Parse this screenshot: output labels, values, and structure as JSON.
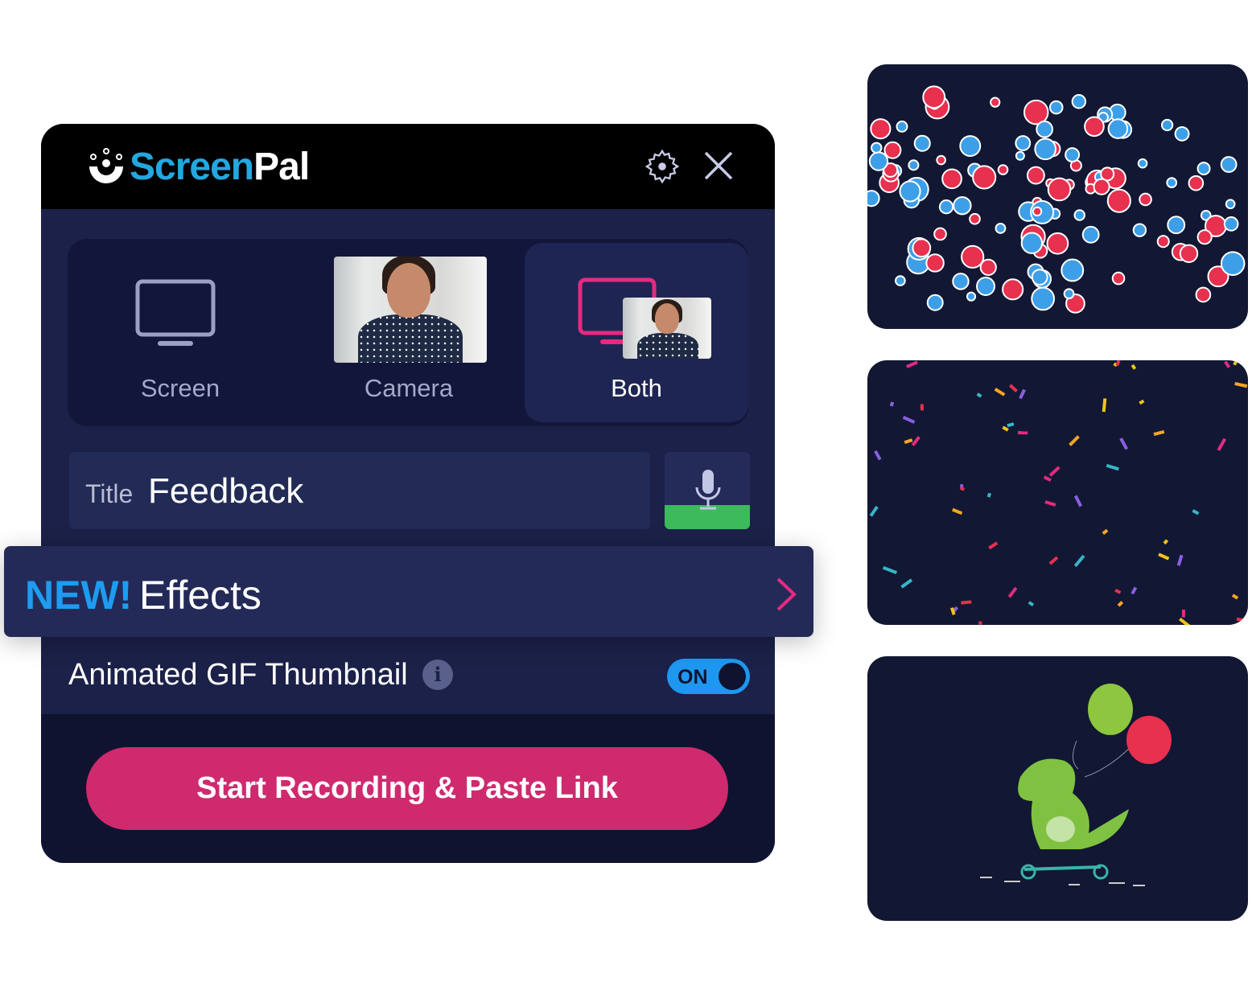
{
  "app": {
    "logo_part1": "Screen",
    "logo_part2": "Pal"
  },
  "header": {
    "settings_icon": "gear-icon",
    "close_icon": "close-icon"
  },
  "modes": [
    {
      "label": "Screen",
      "selected": false
    },
    {
      "label": "Camera",
      "selected": false
    },
    {
      "label": "Both",
      "selected": true
    }
  ],
  "title_field": {
    "label": "Title",
    "value": "Feedback"
  },
  "mic": {
    "icon": "microphone-icon",
    "level_color": "#3dbb5c"
  },
  "effects": {
    "badge": "NEW!",
    "label": "Effects"
  },
  "gif_thumbnail": {
    "label": "Animated GIF Thumbnail",
    "info_icon": "i",
    "toggle": "ON",
    "enabled": true
  },
  "record_button": {
    "label": "Start Recording & Paste Link",
    "color": "#cf2a6e"
  },
  "effect_previews": [
    {
      "name": "hearts-and-likes"
    },
    {
      "name": "confetti"
    },
    {
      "name": "dinosaur-balloons"
    }
  ]
}
